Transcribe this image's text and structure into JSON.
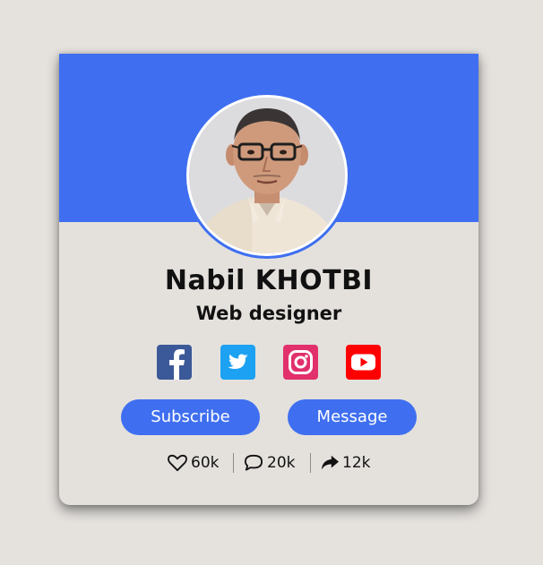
{
  "profile": {
    "name": "Nabil KHOTBI",
    "role": "Web designer"
  },
  "social": [
    {
      "icon": "facebook-icon",
      "color": "#3b5998"
    },
    {
      "icon": "twitter-icon",
      "color": "#1da1f2"
    },
    {
      "icon": "instagram-icon",
      "color": "#e1306c"
    },
    {
      "icon": "youtube-icon",
      "color": "#ff0000"
    }
  ],
  "actions": {
    "subscribe_label": "Subscribe",
    "message_label": "Message"
  },
  "stats": {
    "likes": "60k",
    "comments": "20k",
    "shares": "12k"
  },
  "colors": {
    "accent": "#3f6ff0",
    "background": "#e5e2de"
  }
}
